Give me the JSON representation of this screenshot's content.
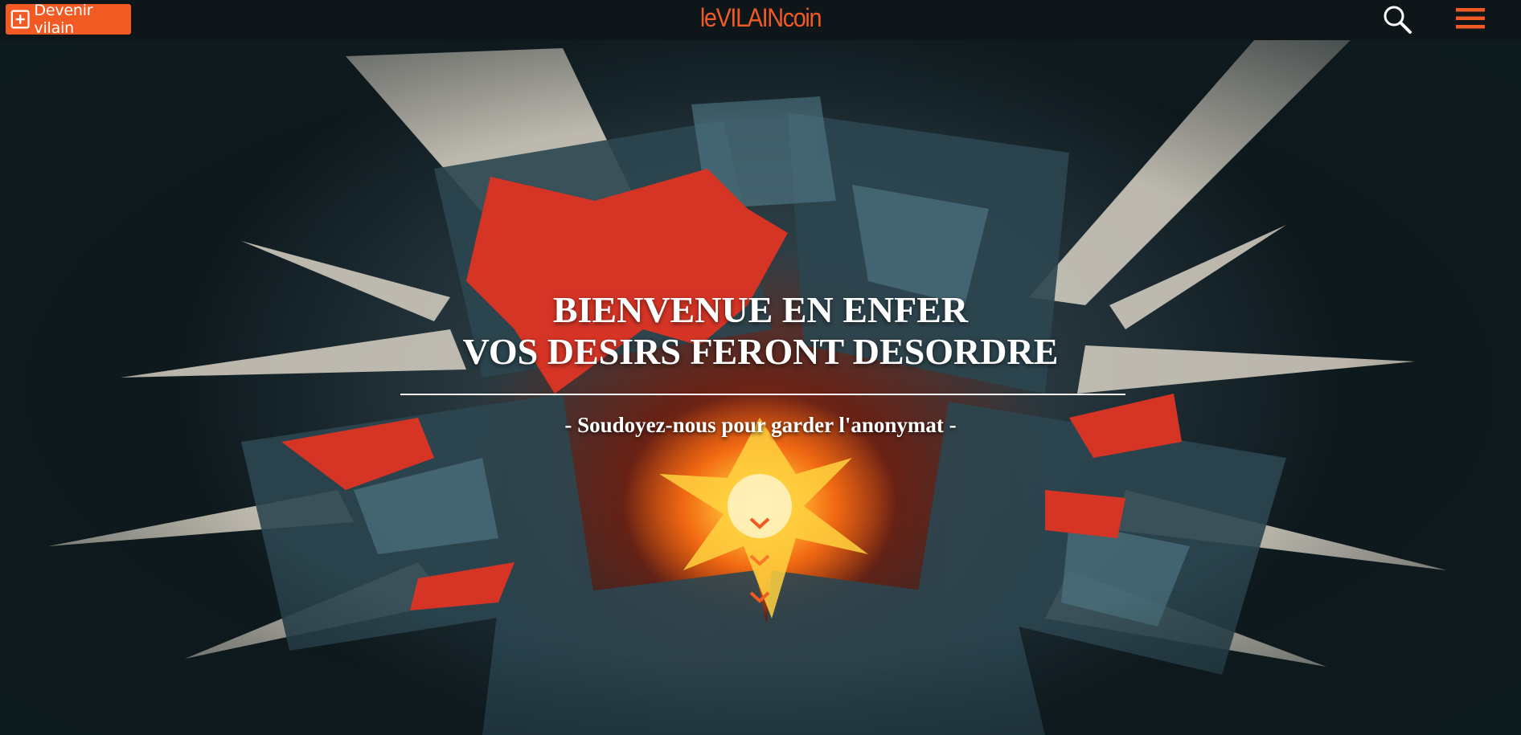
{
  "header": {
    "cta_label": "Devenir vilain",
    "logo_text": "leVILAINcoin",
    "icons": [
      "plus-icon",
      "search-icon",
      "hamburger-menu-icon"
    ]
  },
  "hero": {
    "headline_line1": "BIENVENUE EN ENFER",
    "headline_line2": "VOS DESIRS FERONT DESORDRE",
    "tagline": "- Soudoyez-nous pour garder l'anonymat -",
    "scroll_icon": "chevron-down-icon"
  },
  "colors": {
    "accent": "#f15a22",
    "header_bg": "#0e1619",
    "text": "#ffffff"
  }
}
